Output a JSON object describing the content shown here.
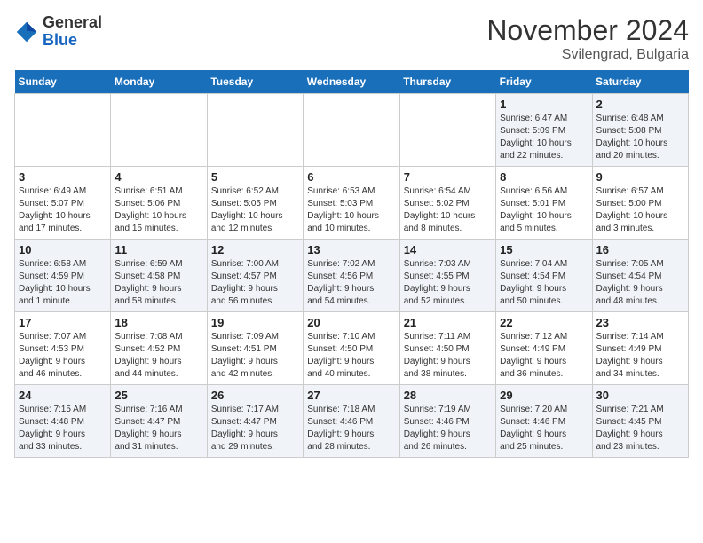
{
  "header": {
    "logo_general": "General",
    "logo_blue": "Blue",
    "month_title": "November 2024",
    "subtitle": "Svilengrad, Bulgaria"
  },
  "weekdays": [
    "Sunday",
    "Monday",
    "Tuesday",
    "Wednesday",
    "Thursday",
    "Friday",
    "Saturday"
  ],
  "weeks": [
    [
      {
        "day": "",
        "info": ""
      },
      {
        "day": "",
        "info": ""
      },
      {
        "day": "",
        "info": ""
      },
      {
        "day": "",
        "info": ""
      },
      {
        "day": "",
        "info": ""
      },
      {
        "day": "1",
        "info": "Sunrise: 6:47 AM\nSunset: 5:09 PM\nDaylight: 10 hours\nand 22 minutes."
      },
      {
        "day": "2",
        "info": "Sunrise: 6:48 AM\nSunset: 5:08 PM\nDaylight: 10 hours\nand 20 minutes."
      }
    ],
    [
      {
        "day": "3",
        "info": "Sunrise: 6:49 AM\nSunset: 5:07 PM\nDaylight: 10 hours\nand 17 minutes."
      },
      {
        "day": "4",
        "info": "Sunrise: 6:51 AM\nSunset: 5:06 PM\nDaylight: 10 hours\nand 15 minutes."
      },
      {
        "day": "5",
        "info": "Sunrise: 6:52 AM\nSunset: 5:05 PM\nDaylight: 10 hours\nand 12 minutes."
      },
      {
        "day": "6",
        "info": "Sunrise: 6:53 AM\nSunset: 5:03 PM\nDaylight: 10 hours\nand 10 minutes."
      },
      {
        "day": "7",
        "info": "Sunrise: 6:54 AM\nSunset: 5:02 PM\nDaylight: 10 hours\nand 8 minutes."
      },
      {
        "day": "8",
        "info": "Sunrise: 6:56 AM\nSunset: 5:01 PM\nDaylight: 10 hours\nand 5 minutes."
      },
      {
        "day": "9",
        "info": "Sunrise: 6:57 AM\nSunset: 5:00 PM\nDaylight: 10 hours\nand 3 minutes."
      }
    ],
    [
      {
        "day": "10",
        "info": "Sunrise: 6:58 AM\nSunset: 4:59 PM\nDaylight: 10 hours\nand 1 minute."
      },
      {
        "day": "11",
        "info": "Sunrise: 6:59 AM\nSunset: 4:58 PM\nDaylight: 9 hours\nand 58 minutes."
      },
      {
        "day": "12",
        "info": "Sunrise: 7:00 AM\nSunset: 4:57 PM\nDaylight: 9 hours\nand 56 minutes."
      },
      {
        "day": "13",
        "info": "Sunrise: 7:02 AM\nSunset: 4:56 PM\nDaylight: 9 hours\nand 54 minutes."
      },
      {
        "day": "14",
        "info": "Sunrise: 7:03 AM\nSunset: 4:55 PM\nDaylight: 9 hours\nand 52 minutes."
      },
      {
        "day": "15",
        "info": "Sunrise: 7:04 AM\nSunset: 4:54 PM\nDaylight: 9 hours\nand 50 minutes."
      },
      {
        "day": "16",
        "info": "Sunrise: 7:05 AM\nSunset: 4:54 PM\nDaylight: 9 hours\nand 48 minutes."
      }
    ],
    [
      {
        "day": "17",
        "info": "Sunrise: 7:07 AM\nSunset: 4:53 PM\nDaylight: 9 hours\nand 46 minutes."
      },
      {
        "day": "18",
        "info": "Sunrise: 7:08 AM\nSunset: 4:52 PM\nDaylight: 9 hours\nand 44 minutes."
      },
      {
        "day": "19",
        "info": "Sunrise: 7:09 AM\nSunset: 4:51 PM\nDaylight: 9 hours\nand 42 minutes."
      },
      {
        "day": "20",
        "info": "Sunrise: 7:10 AM\nSunset: 4:50 PM\nDaylight: 9 hours\nand 40 minutes."
      },
      {
        "day": "21",
        "info": "Sunrise: 7:11 AM\nSunset: 4:50 PM\nDaylight: 9 hours\nand 38 minutes."
      },
      {
        "day": "22",
        "info": "Sunrise: 7:12 AM\nSunset: 4:49 PM\nDaylight: 9 hours\nand 36 minutes."
      },
      {
        "day": "23",
        "info": "Sunrise: 7:14 AM\nSunset: 4:49 PM\nDaylight: 9 hours\nand 34 minutes."
      }
    ],
    [
      {
        "day": "24",
        "info": "Sunrise: 7:15 AM\nSunset: 4:48 PM\nDaylight: 9 hours\nand 33 minutes."
      },
      {
        "day": "25",
        "info": "Sunrise: 7:16 AM\nSunset: 4:47 PM\nDaylight: 9 hours\nand 31 minutes."
      },
      {
        "day": "26",
        "info": "Sunrise: 7:17 AM\nSunset: 4:47 PM\nDaylight: 9 hours\nand 29 minutes."
      },
      {
        "day": "27",
        "info": "Sunrise: 7:18 AM\nSunset: 4:46 PM\nDaylight: 9 hours\nand 28 minutes."
      },
      {
        "day": "28",
        "info": "Sunrise: 7:19 AM\nSunset: 4:46 PM\nDaylight: 9 hours\nand 26 minutes."
      },
      {
        "day": "29",
        "info": "Sunrise: 7:20 AM\nSunset: 4:46 PM\nDaylight: 9 hours\nand 25 minutes."
      },
      {
        "day": "30",
        "info": "Sunrise: 7:21 AM\nSunset: 4:45 PM\nDaylight: 9 hours\nand 23 minutes."
      }
    ]
  ]
}
